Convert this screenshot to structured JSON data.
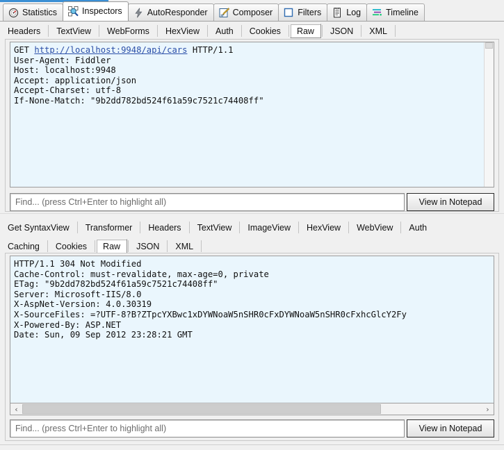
{
  "window": {
    "accent_color": "#3b8fd4",
    "pane_bg_color": "#eaf6fd",
    "chrome_bg_color": "#f0f0f0"
  },
  "main_tabs": [
    {
      "label": "Statistics",
      "icon": "statistics-icon",
      "active": false
    },
    {
      "label": "Inspectors",
      "icon": "inspectors-icon",
      "active": true
    },
    {
      "label": "AutoResponder",
      "icon": "autoresponder-icon",
      "active": false
    },
    {
      "label": "Composer",
      "icon": "composer-icon",
      "active": false
    },
    {
      "label": "Filters",
      "icon": "filters-icon",
      "active": false
    },
    {
      "label": "Log",
      "icon": "log-icon",
      "active": false
    },
    {
      "label": "Timeline",
      "icon": "timeline-icon",
      "active": false
    }
  ],
  "request": {
    "tabs": [
      {
        "label": "Headers",
        "selected": false
      },
      {
        "label": "TextView",
        "selected": false
      },
      {
        "label": "WebForms",
        "selected": false
      },
      {
        "label": "HexView",
        "selected": false
      },
      {
        "label": "Auth",
        "selected": false
      },
      {
        "label": "Cookies",
        "selected": false
      },
      {
        "label": "Raw",
        "selected": true
      },
      {
        "label": "JSON",
        "selected": false
      },
      {
        "label": "XML",
        "selected": false
      }
    ],
    "raw_prefix": "GET ",
    "raw_url": "http://localhost:9948/api/cars",
    "raw_suffix": " HTTP/1.1",
    "raw_headers": "User-Agent: Fiddler\nHost: localhost:9948\nAccept: application/json\nAccept-Charset: utf-8\nIf-None-Match: \"9b2dd782bd524f61a59c7521c74408ff\"",
    "find_placeholder": "Find... (press Ctrl+Enter to highlight all)",
    "find_value": "",
    "notepad_label": "View in Notepad"
  },
  "response": {
    "tabs_row1": [
      {
        "label": "Get SyntaxView",
        "selected": false
      },
      {
        "label": "Transformer",
        "selected": false
      },
      {
        "label": "Headers",
        "selected": false
      },
      {
        "label": "TextView",
        "selected": false
      },
      {
        "label": "ImageView",
        "selected": false
      },
      {
        "label": "HexView",
        "selected": false
      },
      {
        "label": "WebView",
        "selected": false
      },
      {
        "label": "Auth",
        "selected": false
      }
    ],
    "tabs_row2": [
      {
        "label": "Caching",
        "selected": false
      },
      {
        "label": "Cookies",
        "selected": false
      },
      {
        "label": "Raw",
        "selected": true
      },
      {
        "label": "JSON",
        "selected": false
      },
      {
        "label": "XML",
        "selected": false
      }
    ],
    "raw_text": "HTTP/1.1 304 Not Modified\nCache-Control: must-revalidate, max-age=0, private\nETag: \"9b2dd782bd524f61a59c7521c74408ff\"\nServer: Microsoft-IIS/8.0\nX-AspNet-Version: 4.0.30319\nX-SourceFiles: =?UTF-8?B?ZTpcYXBwc1xDYWNoaW5nSHR0cFxDYWNoaW5nSHR0cFxhcGlcY2Fy\nX-Powered-By: ASP.NET\nDate: Sun, 09 Sep 2012 23:28:21 GMT",
    "find_placeholder": "Find... (press Ctrl+Enter to highlight all)",
    "find_value": "",
    "notepad_label": "View in Notepad",
    "hscroll_left_glyph": "‹",
    "hscroll_right_glyph": "›"
  }
}
